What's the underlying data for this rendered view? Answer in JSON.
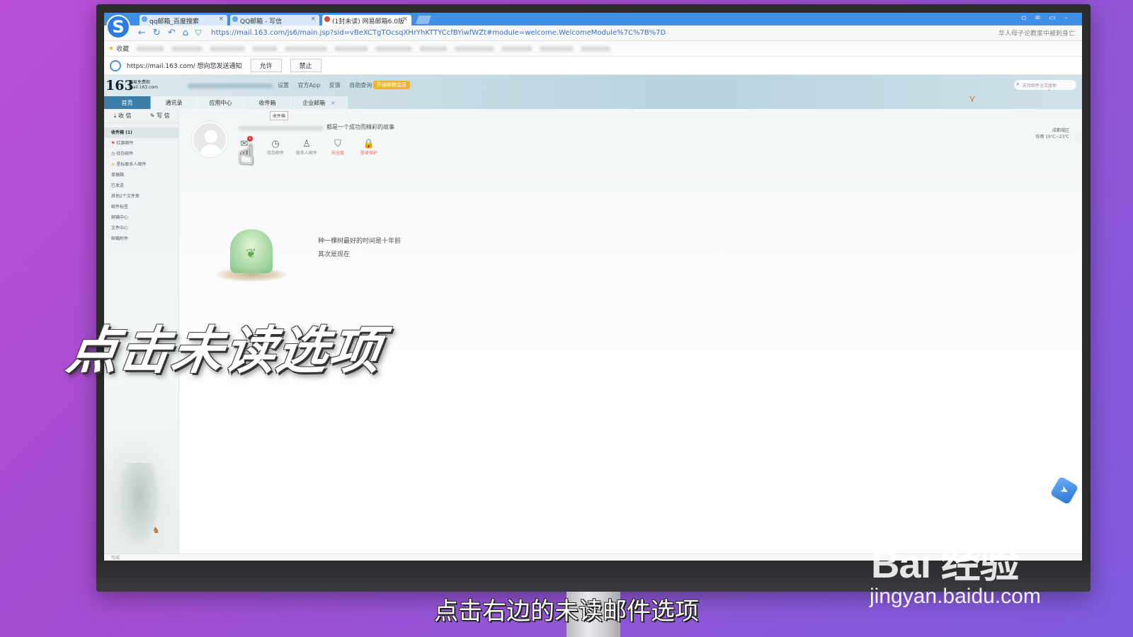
{
  "browser": {
    "logo": "S",
    "tabs": [
      {
        "title": "qq邮箱_百度搜索"
      },
      {
        "title": "QQ邮箱 - 写信"
      },
      {
        "title": "(1封未读) 网易邮箱6.0版"
      }
    ],
    "url": "https://mail.163.com/js6/main.jsp?sid=vBeXCTgTOcsqXHrYhKTTYCcfBYiwfWZt#module=welcome.WelcomeModule%7C%7B%7D",
    "address_right": "华人母子论教家中被刺身亡",
    "favorites_label": "收藏"
  },
  "notification": {
    "text": "https://mail.163.com/ 想向您发送通知",
    "allow": "允许",
    "deny": "禁止"
  },
  "mail": {
    "logo": "163",
    "logo_sub1": "网易免费邮",
    "logo_sub2": "mail.163.com",
    "top_links": [
      "设置",
      "官方App",
      "反馈",
      "自助查询"
    ],
    "vip_button": "开通邮箱会员",
    "search_placeholder": "支持邮件全文搜索",
    "nav_tabs": [
      "首页",
      "通讯录",
      "应用中心",
      "收件箱",
      "企业邮箱"
    ],
    "receive": "收 信",
    "compose": "写 信",
    "folders": [
      "收件箱 (1)",
      "红旗邮件",
      "待办邮件",
      "星标联系人邮件",
      "草稿箱",
      "已发送",
      "其他2个文件夹",
      "邮件标签",
      "邮箱中心",
      "文件中心",
      "邮箱附件"
    ],
    "greeting": "都是一个成功而精彩的故事",
    "quick_items": [
      {
        "label": "未读",
        "icon": "✉"
      },
      {
        "label": "待办邮件",
        "icon": "◷"
      },
      {
        "label": "联系人邮件",
        "icon": "♙"
      },
      {
        "label": "安全度",
        "icon": "⛉"
      },
      {
        "label": "登录保护",
        "icon": "🔒"
      }
    ],
    "unread_badge": "1",
    "tooltip": "收件箱",
    "weather_city": "成都城区",
    "weather_temp": "阵雨 19℃~23℃",
    "quote_line1": "种一棵树最好的时间是十年前",
    "quote_line2": "其次是现在",
    "status": "完成"
  },
  "overlay": {
    "title": "点击未读选项",
    "caption": "点击右边的未读邮件选项",
    "watermark": "Bai   经验",
    "watermark_url": "jingyan.baidu.com"
  }
}
